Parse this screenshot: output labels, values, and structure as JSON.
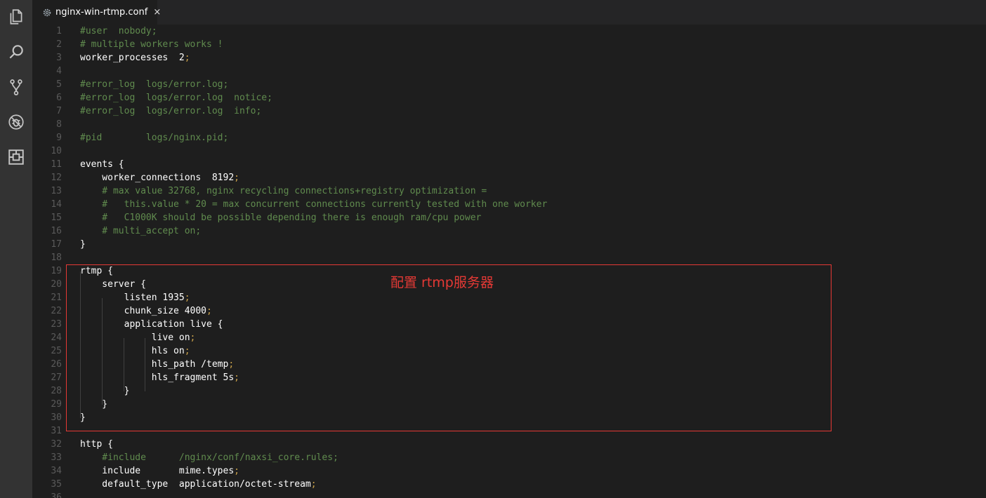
{
  "tab": {
    "label": "nginx-win-rtmp.conf",
    "close": "×"
  },
  "activity": [
    {
      "name": "explorer-icon"
    },
    {
      "name": "search-icon"
    },
    {
      "name": "source-control-icon"
    },
    {
      "name": "debug-icon"
    },
    {
      "name": "extensions-icon"
    }
  ],
  "annotation": "配置 rtmp服务器",
  "colors": {
    "comment": "#608b4e",
    "punct": "#c8a04a",
    "box": "#e53935"
  },
  "lines": [
    {
      "n": "1",
      "parts": [
        {
          "t": "#user  nobody;",
          "c": "cm"
        }
      ]
    },
    {
      "n": "2",
      "parts": [
        {
          "t": "# multiple workers works !",
          "c": "cm"
        }
      ]
    },
    {
      "n": "3",
      "parts": [
        {
          "t": "worker_processes  2",
          "c": "kw"
        },
        {
          "t": ";",
          "c": "pn"
        }
      ]
    },
    {
      "n": "4",
      "parts": []
    },
    {
      "n": "5",
      "parts": [
        {
          "t": "#error_log  logs/error.log;",
          "c": "cm"
        }
      ]
    },
    {
      "n": "6",
      "parts": [
        {
          "t": "#error_log  logs/error.log  notice;",
          "c": "cm"
        }
      ]
    },
    {
      "n": "7",
      "parts": [
        {
          "t": "#error_log  logs/error.log  info;",
          "c": "cm"
        }
      ]
    },
    {
      "n": "8",
      "parts": []
    },
    {
      "n": "9",
      "parts": [
        {
          "t": "#pid        logs/nginx.pid;",
          "c": "cm"
        }
      ]
    },
    {
      "n": "10",
      "parts": []
    },
    {
      "n": "11",
      "parts": [
        {
          "t": "events {",
          "c": "kw"
        }
      ]
    },
    {
      "n": "12",
      "parts": [
        {
          "t": "    worker_connections  8192",
          "c": "kw"
        },
        {
          "t": ";",
          "c": "pn"
        }
      ]
    },
    {
      "n": "13",
      "parts": [
        {
          "t": "    # max value 32768, nginx recycling connections+registry optimization =",
          "c": "cm"
        }
      ]
    },
    {
      "n": "14",
      "parts": [
        {
          "t": "    #   this.value * 20 = max concurrent connections currently tested with one worker",
          "c": "cm"
        }
      ]
    },
    {
      "n": "15",
      "parts": [
        {
          "t": "    #   C1000K should be possible depending there is enough ram/cpu power",
          "c": "cm"
        }
      ]
    },
    {
      "n": "16",
      "parts": [
        {
          "t": "    # multi_accept on;",
          "c": "cm"
        }
      ]
    },
    {
      "n": "17",
      "parts": [
        {
          "t": "}",
          "c": "kw"
        }
      ]
    },
    {
      "n": "18",
      "parts": []
    },
    {
      "n": "19",
      "parts": [
        {
          "t": "rtmp {",
          "c": "kw"
        }
      ]
    },
    {
      "n": "20",
      "parts": [
        {
          "t": "    server {",
          "c": "kw"
        }
      ]
    },
    {
      "n": "21",
      "parts": [
        {
          "t": "        listen 1935",
          "c": "kw"
        },
        {
          "t": ";",
          "c": "pn"
        }
      ]
    },
    {
      "n": "22",
      "parts": [
        {
          "t": "        chunk_size 4000",
          "c": "kw"
        },
        {
          "t": ";",
          "c": "pn"
        }
      ]
    },
    {
      "n": "23",
      "parts": [
        {
          "t": "        application live {",
          "c": "kw"
        }
      ]
    },
    {
      "n": "24",
      "parts": [
        {
          "t": "             live on",
          "c": "kw"
        },
        {
          "t": ";",
          "c": "pn"
        }
      ]
    },
    {
      "n": "25",
      "parts": [
        {
          "t": "             hls on",
          "c": "kw"
        },
        {
          "t": ";",
          "c": "pn"
        }
      ]
    },
    {
      "n": "26",
      "parts": [
        {
          "t": "             hls_path /temp",
          "c": "kw"
        },
        {
          "t": ";",
          "c": "pn"
        }
      ]
    },
    {
      "n": "27",
      "parts": [
        {
          "t": "             hls_fragment 5s",
          "c": "kw"
        },
        {
          "t": ";",
          "c": "pn"
        }
      ]
    },
    {
      "n": "28",
      "parts": [
        {
          "t": "        }",
          "c": "kw"
        }
      ]
    },
    {
      "n": "29",
      "parts": [
        {
          "t": "    }",
          "c": "kw"
        }
      ]
    },
    {
      "n": "30",
      "parts": [
        {
          "t": "}",
          "c": "kw"
        }
      ]
    },
    {
      "n": "31",
      "parts": []
    },
    {
      "n": "32",
      "parts": [
        {
          "t": "http {",
          "c": "kw"
        }
      ]
    },
    {
      "n": "33",
      "parts": [
        {
          "t": "    #include      /nginx/conf/naxsi_core.rules;",
          "c": "cm"
        }
      ]
    },
    {
      "n": "34",
      "parts": [
        {
          "t": "    include       mime.types",
          "c": "kw"
        },
        {
          "t": ";",
          "c": "pn"
        }
      ]
    },
    {
      "n": "35",
      "parts": [
        {
          "t": "    default_type  application/octet-stream",
          "c": "kw"
        },
        {
          "t": ";",
          "c": "pn"
        }
      ]
    },
    {
      "n": "36",
      "parts": []
    }
  ]
}
